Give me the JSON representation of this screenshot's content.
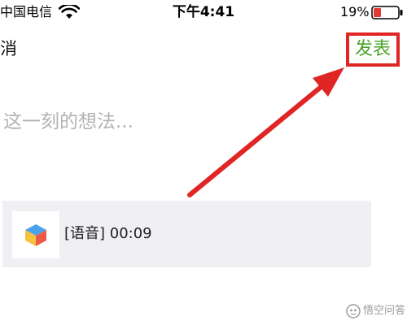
{
  "status_bar": {
    "carrier": "中国电信",
    "time": "下午4:41",
    "battery_percent": "19%",
    "battery_level": 0.19,
    "battery_color": "#e53935",
    "wifi_icon": "wifi-icon"
  },
  "nav": {
    "cancel_label": "消",
    "publish_label": "发表",
    "publish_color": "#4aa52a",
    "highlight_color": "#e02525"
  },
  "composer": {
    "placeholder": "这一刻的想法..."
  },
  "voice_card": {
    "label": "[语音] 00:09",
    "thumbnail_icon": "cube-icon"
  },
  "annotation": {
    "arrow_color": "#e02525"
  },
  "watermark": {
    "text": "悟空问答"
  }
}
